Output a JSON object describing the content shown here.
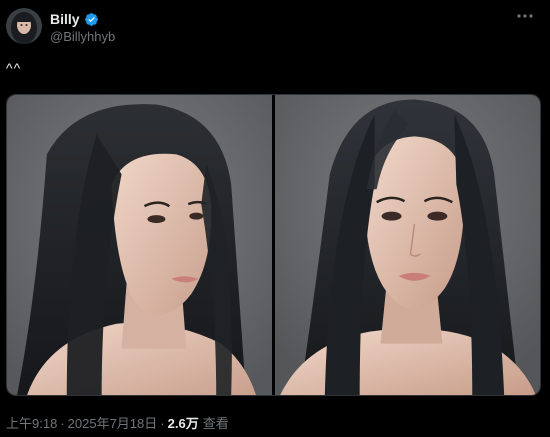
{
  "author": {
    "display_name": "Billy",
    "handle": "@Billyhhyb",
    "verified": true
  },
  "tweet": {
    "text": "^^",
    "media": [
      {
        "alt": "3D rendered portrait, head turned right"
      },
      {
        "alt": "3D rendered portrait, facing forward"
      }
    ]
  },
  "meta": {
    "time": "上午9:18",
    "date": "2025年7月18日",
    "views_count": "2.6万",
    "views_label": "查看",
    "separator": "·"
  },
  "icons": {
    "verified": "verified-badge-icon",
    "more": "more-dots-icon"
  },
  "colors": {
    "background": "#000000",
    "primary_text": "#e7e9ea",
    "secondary_text": "#71767b",
    "verified_blue": "#1d9bf0",
    "border": "#2f3336"
  }
}
